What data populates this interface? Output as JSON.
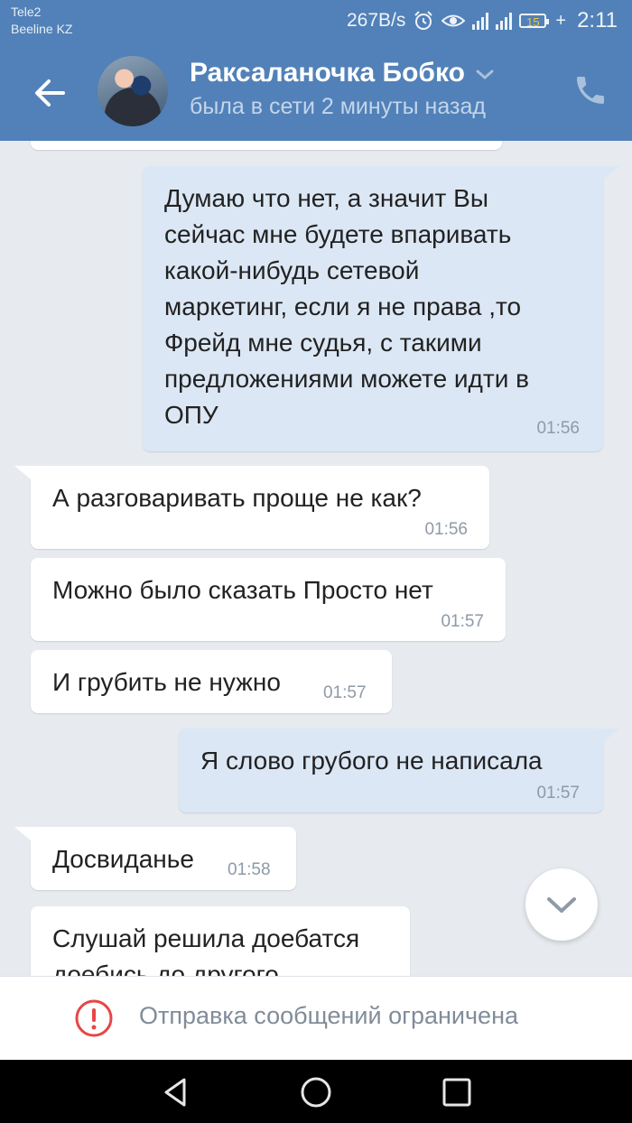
{
  "status_bar": {
    "carrier1": "Tele2",
    "carrier2": "Beeline KZ",
    "speed": "267B/s",
    "battery": "15",
    "plus": "+",
    "time": "2:11"
  },
  "header": {
    "contact_name": "Раксаланочка Бобко",
    "last_seen": "была в сети 2 минуты назад",
    "colors": {
      "bar": "#5181b8",
      "status_text": "#c4d5ea"
    }
  },
  "messages": [
    {
      "direction": "out",
      "text": "Думаю что нет, а значит Вы\nсейчас мне будете впаривать\nкакой-нибудь сетевой\nмаркетинг, если я не права ,то\nФрейд мне судья, с такими\nпредложениями можете идти в\nОПУ",
      "time": "01:56"
    },
    {
      "direction": "in",
      "text": "А разговаривать проще не как?",
      "time": "01:56"
    },
    {
      "direction": "in",
      "text": "Можно было сказать Просто нет",
      "time": "01:57"
    },
    {
      "direction": "in",
      "text": "И грубить не нужно",
      "time": "01:57"
    },
    {
      "direction": "out",
      "text": "Я слово грубого не написала",
      "time": "01:57"
    },
    {
      "direction": "in",
      "text": "Досвиданье",
      "time": "01:58"
    },
    {
      "direction": "in",
      "text": "Слушай решила доебатся\nдоебись до другого",
      "time": ""
    }
  ],
  "composer": {
    "restriction_text": "Отправка сообщений ограничена",
    "warning_color": "#e64646"
  },
  "icons": {
    "back": "arrow-left-icon",
    "call": "phone-icon",
    "scroll_down": "chevron-down-icon",
    "warning": "exclamation-circle-icon",
    "nav_back": "triangle-back-icon",
    "nav_home": "circle-home-icon",
    "nav_recents": "square-recents-icon"
  }
}
